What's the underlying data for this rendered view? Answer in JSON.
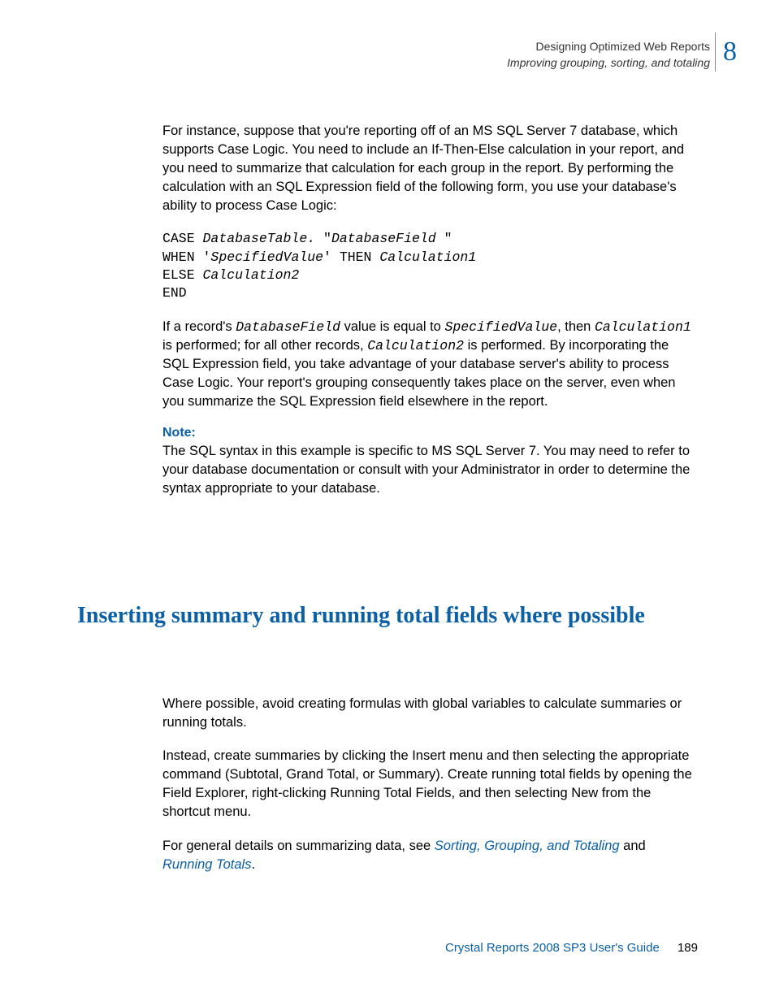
{
  "header": {
    "chapter_title": "Designing Optimized Web Reports",
    "section_title": "Improving grouping, sorting, and totaling",
    "chapter_number": "8"
  },
  "intro": {
    "para1": "For instance, suppose that you're reporting off of an MS SQL Server 7 database, which supports Case Logic. You need to include an If-Then-Else calculation in your report, and you need to summarize that calculation for each group in the report. By performing the calculation with an SQL Expression field of the following form, you use your database's ability to process Case Logic:"
  },
  "code": {
    "l1a": "CASE ",
    "l1b": "DatabaseTable.",
    "l1c": " \"",
    "l1d": "DatabaseField",
    "l1e": " \"",
    "l2a": "WHEN '",
    "l2b": "SpecifiedValue",
    "l2c": "' THEN ",
    "l2d": "Calculation1",
    "l3a": "ELSE ",
    "l3b": "Calculation2",
    "l4": "END"
  },
  "explain": {
    "p2a": "If a record's ",
    "p2b": "DatabaseField",
    "p2c": " value is equal to ",
    "p2d": "SpecifiedValue",
    "p2e": ", then ",
    "p2f": "Calculation1",
    "p2g": " is performed; for all other records, ",
    "p2h": "Calculation2",
    "p2i": " is performed. By incorporating the SQL Expression field, you take advantage of your database server's ability to process Case Logic. Your report's grouping consequently takes place on the server, even when you summarize the SQL Expression field elsewhere in the report."
  },
  "note": {
    "label": "Note:",
    "body": "The SQL syntax in this example is specific to MS SQL Server 7. You may need to refer to your database documentation or consult with your Administrator in order to determine the syntax appropriate to your database."
  },
  "heading": "Inserting summary and running total fields where possible",
  "section2": {
    "p1": "Where possible, avoid creating formulas with global variables to calculate summaries or running totals.",
    "p2": "Instead, create summaries by clicking the Insert menu and then selecting the appropriate command (Subtotal, Grand Total, or Summary). Create running total fields by opening the Field Explorer, right-clicking Running Total Fields, and then selecting New from the shortcut menu.",
    "p3a": "For general details on summarizing data, see ",
    "link1": "Sorting, Grouping, and Totaling",
    "p3b": " and ",
    "link2": "Running Totals",
    "p3c": "."
  },
  "footer": {
    "guide": "Crystal Reports 2008 SP3 User's Guide",
    "page": "189"
  }
}
